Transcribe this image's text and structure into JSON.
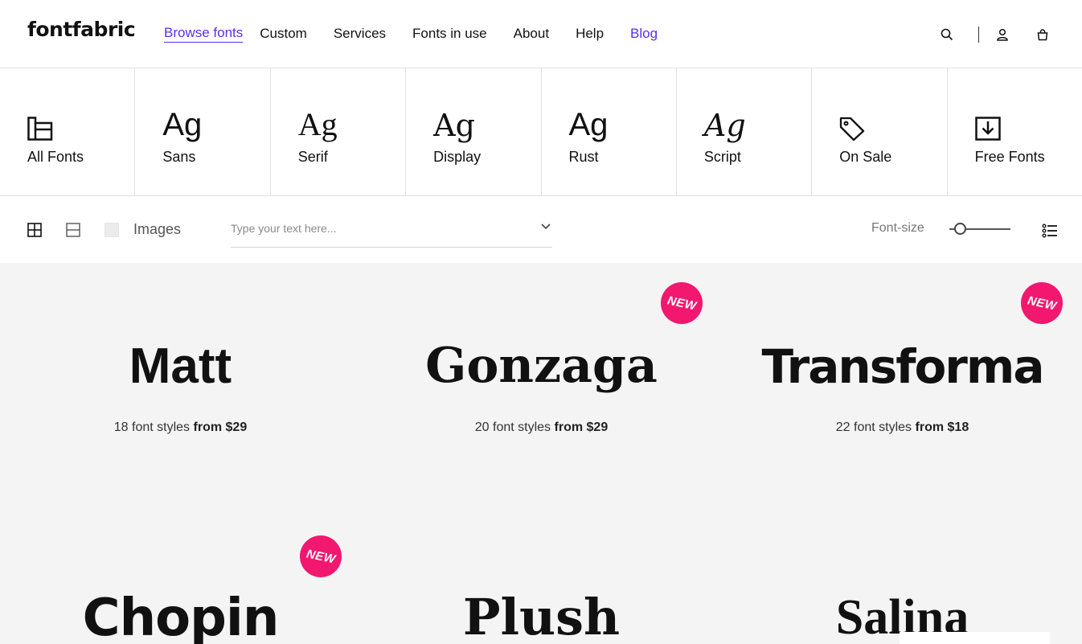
{
  "header": {
    "logo": "fontfabric",
    "nav": [
      {
        "label": "Browse fonts",
        "state": "active"
      },
      {
        "label": "Custom"
      },
      {
        "label": "Services"
      },
      {
        "label": "Fonts in use"
      },
      {
        "label": "About"
      },
      {
        "label": "Help"
      },
      {
        "label": "Blog",
        "state": "accent"
      }
    ],
    "icons": [
      "search-icon",
      "user-icon",
      "cart-icon"
    ]
  },
  "categories": [
    {
      "label": "All Fonts",
      "icon": "folder-icon"
    },
    {
      "label": "Sans",
      "glyph": "Ag"
    },
    {
      "label": "Serif",
      "glyph": "Ag"
    },
    {
      "label": "Display",
      "glyph": "Ag"
    },
    {
      "label": "Rust",
      "glyph": "Ag"
    },
    {
      "label": "Script",
      "glyph": "Ag"
    },
    {
      "label": "On Sale",
      "icon": "tag-icon"
    },
    {
      "label": "Free Fonts",
      "icon": "download-icon"
    }
  ],
  "toolbar": {
    "images_label": "Images",
    "text_placeholder": "Type your text here...",
    "font_size_label": "Font-size",
    "font_size_level": 0.1
  },
  "fonts": [
    {
      "name": "Matt",
      "styles": "18 font styles",
      "price": "from $29",
      "badge": ""
    },
    {
      "name": "Gonzaga",
      "styles": "20 font styles",
      "price": "from $29",
      "badge": "NEW"
    },
    {
      "name": "Transforma",
      "styles": "22 font styles",
      "price": "from $18",
      "badge": "NEW"
    },
    {
      "name": "Chopin",
      "badge": "NEW"
    },
    {
      "name": "Plush",
      "badge": ""
    },
    {
      "name": "Salina",
      "badge": ""
    }
  ],
  "colors": {
    "accent": "#5b2df5",
    "badge": "#f2176f",
    "grid_bg": "#f4f4f4",
    "border": "#e2e2e2"
  }
}
